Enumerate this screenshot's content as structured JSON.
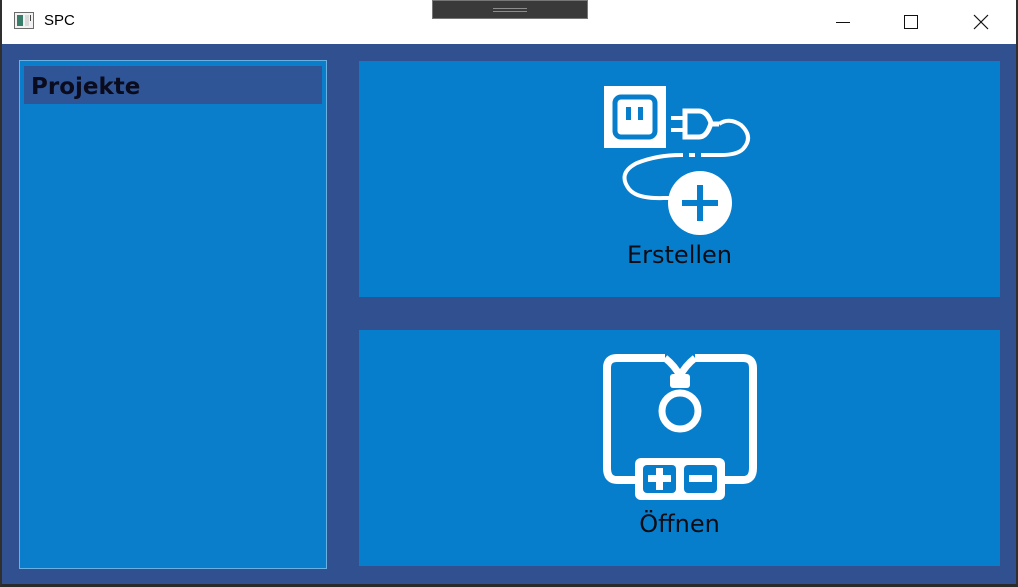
{
  "window": {
    "title": "SPC"
  },
  "sidebar": {
    "title": "Projekte",
    "items": []
  },
  "tiles": {
    "create": {
      "label": "Erstellen",
      "icon": "plug-add-icon"
    },
    "open": {
      "label": "Öffnen",
      "icon": "circuit-board-open-icon"
    }
  },
  "colors": {
    "background": "#315090",
    "tile": "#077ecc",
    "sidebar_header": "#2f5597"
  }
}
